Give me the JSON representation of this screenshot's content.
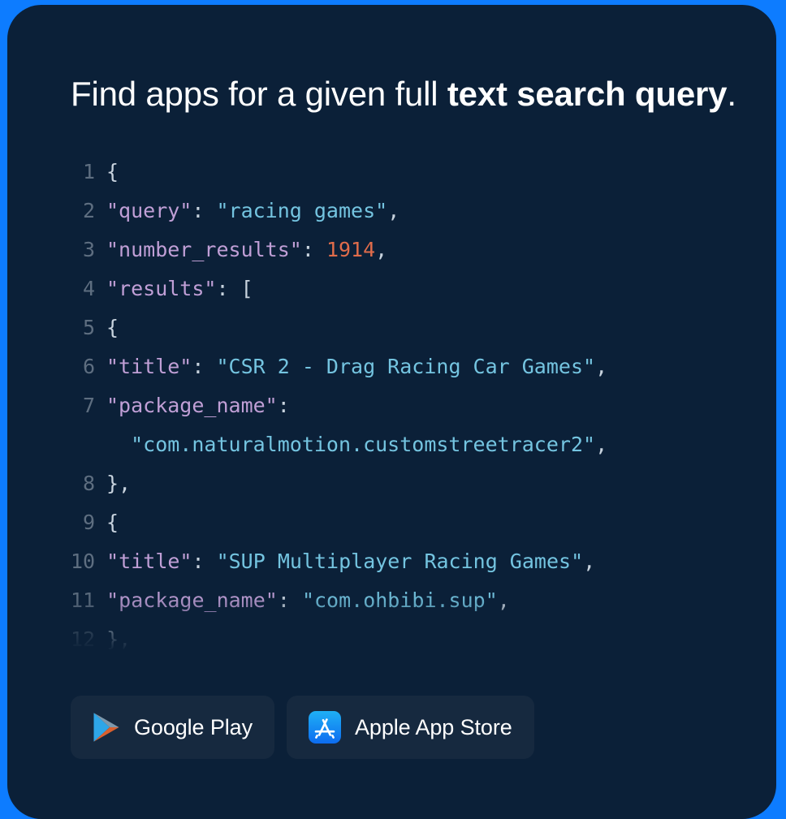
{
  "theme": {
    "frame_color": "#0d7cff",
    "card_color": "#0b2038",
    "button_color": "#16293f",
    "text_color": "#ffffff",
    "line_number_color": "#5e6e80",
    "token_key_color": "#c09fd6",
    "token_string_color": "#74c4e0",
    "token_number_color": "#e06c4b",
    "token_punct_color": "#c8d3de"
  },
  "heading": {
    "lead": "Find apps for a given full ",
    "emphasis": "text search query",
    "trail": "."
  },
  "code": {
    "language": "json",
    "lines": [
      {
        "number": "1",
        "tokens": [
          {
            "text": "{",
            "type": "punct"
          }
        ]
      },
      {
        "number": "2",
        "tokens": [
          {
            "text": "\"query\"",
            "type": "key"
          },
          {
            "text": ": ",
            "type": "punct"
          },
          {
            "text": "\"racing games\"",
            "type": "str"
          },
          {
            "text": ",",
            "type": "punct"
          }
        ]
      },
      {
        "number": "3",
        "tokens": [
          {
            "text": "\"number_results\"",
            "type": "key"
          },
          {
            "text": ": ",
            "type": "punct"
          },
          {
            "text": "1914",
            "type": "num"
          },
          {
            "text": ",",
            "type": "punct"
          }
        ]
      },
      {
        "number": "4",
        "tokens": [
          {
            "text": "\"results\"",
            "type": "key"
          },
          {
            "text": ": [",
            "type": "punct"
          }
        ]
      },
      {
        "number": "5",
        "tokens": [
          {
            "text": "{",
            "type": "punct"
          }
        ]
      },
      {
        "number": "6",
        "tokens": [
          {
            "text": "\"title\"",
            "type": "key"
          },
          {
            "text": ": ",
            "type": "punct"
          },
          {
            "text": "\"CSR 2 - Drag Racing Car Games\"",
            "type": "str"
          },
          {
            "text": ",",
            "type": "punct"
          }
        ]
      },
      {
        "number": "7",
        "tokens": [
          {
            "text": "\"package_name\"",
            "type": "key"
          },
          {
            "text": ":",
            "type": "punct"
          }
        ]
      },
      {
        "number": "",
        "tokens": [
          {
            "text": "  \"com.naturalmotion.customstreetracer2\"",
            "type": "str"
          },
          {
            "text": ",",
            "type": "punct"
          }
        ]
      },
      {
        "number": "8",
        "tokens": [
          {
            "text": "},",
            "type": "punct"
          }
        ]
      },
      {
        "number": "9",
        "tokens": [
          {
            "text": "{",
            "type": "punct"
          }
        ]
      },
      {
        "number": "10",
        "tokens": [
          {
            "text": "\"title\"",
            "type": "key"
          },
          {
            "text": ": ",
            "type": "punct"
          },
          {
            "text": "\"SUP Multiplayer Racing Games\"",
            "type": "str"
          },
          {
            "text": ",",
            "type": "punct"
          }
        ]
      },
      {
        "number": "11",
        "tokens": [
          {
            "text": "\"package_name\"",
            "type": "key"
          },
          {
            "text": ": ",
            "type": "punct"
          },
          {
            "text": "\"com.ohbibi.sup\"",
            "type": "str"
          },
          {
            "text": ",",
            "type": "punct"
          }
        ]
      },
      {
        "number": "12",
        "tokens": [
          {
            "text": "},",
            "type": "punct"
          }
        ]
      }
    ]
  },
  "store_buttons": [
    {
      "id": "google-play",
      "label": "Google Play",
      "icon": "google-play-icon"
    },
    {
      "id": "apple-app-store",
      "label": "Apple App Store",
      "icon": "apple-app-store-icon"
    }
  ]
}
